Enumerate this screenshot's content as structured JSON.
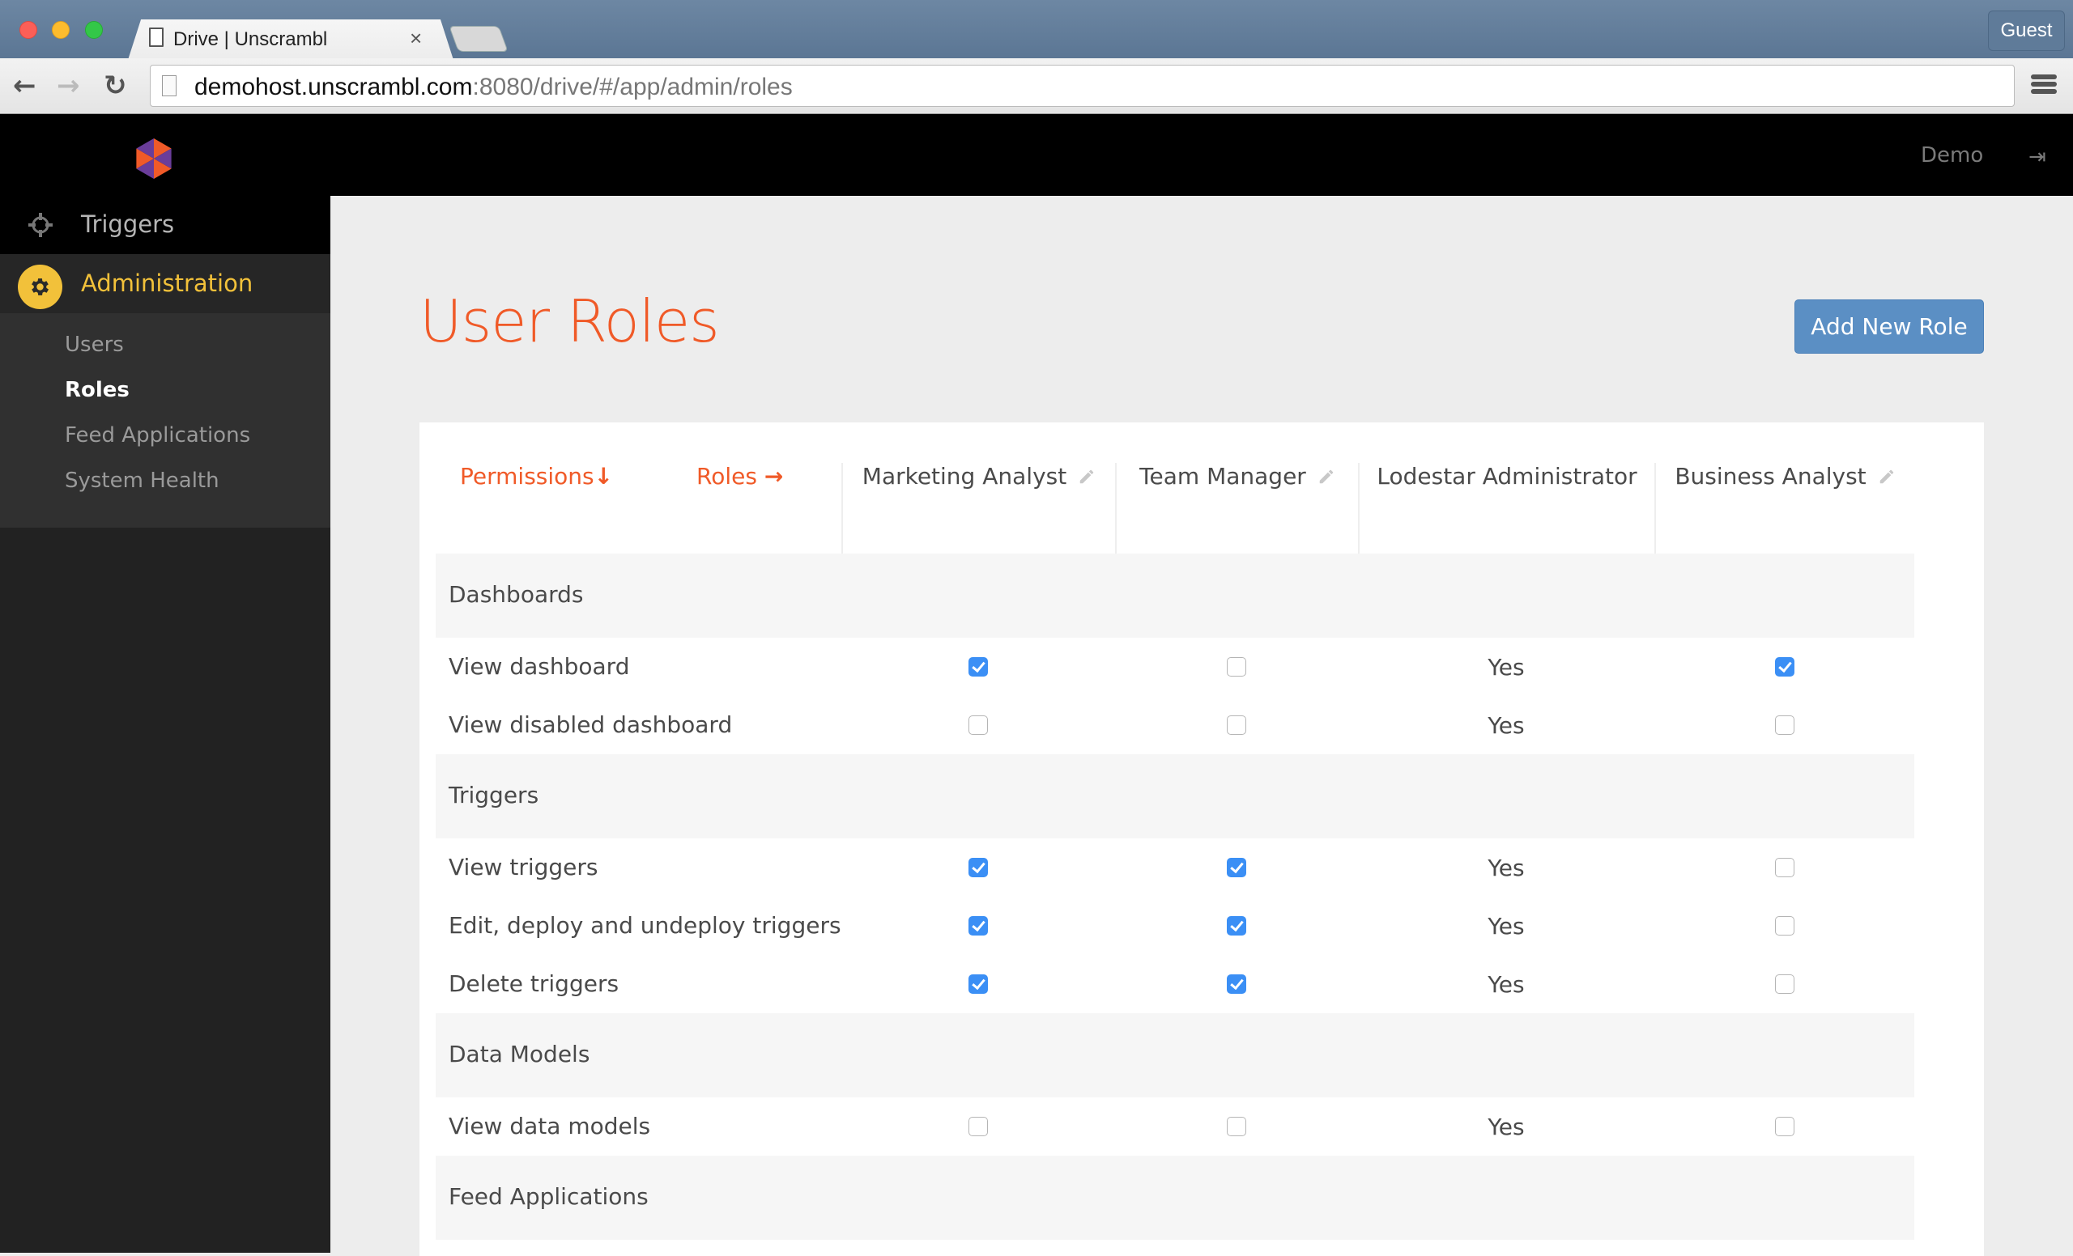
{
  "browser": {
    "tab_title": "Drive | Unscrambl",
    "tab_close": "×",
    "profile": "Guest",
    "url_host": "demohost.unscrambl.com",
    "url_rest": ":8080/drive/#/app/admin/roles",
    "icons": {
      "back": "←",
      "forward": "→",
      "reload": "↻"
    }
  },
  "header": {
    "user": "Demo",
    "logout_icon": "⇥"
  },
  "sidebar": {
    "items": [
      {
        "label": "Triggers",
        "icon": "crosshair-icon"
      },
      {
        "label": "Administration",
        "icon": "gear-icon",
        "active": true
      }
    ],
    "submenu": [
      {
        "label": "Users"
      },
      {
        "label": "Roles",
        "active": true
      },
      {
        "label": "Feed Applications"
      },
      {
        "label": "System Health"
      }
    ]
  },
  "main": {
    "title": "User Roles",
    "add_button": "Add New Role",
    "table": {
      "permissions_header": "Permissions",
      "permissions_arrow": "↓",
      "roles_header": "Roles",
      "roles_arrow": "→",
      "roles": [
        {
          "name": "Marketing Analyst",
          "editable": true
        },
        {
          "name": "Team Manager",
          "editable": true
        },
        {
          "name": "Lodestar Administrator",
          "editable": false
        },
        {
          "name": "Business Analyst",
          "editable": true
        }
      ],
      "yes_label": "Yes",
      "rows": [
        {
          "type": "section",
          "label": "Dashboards"
        },
        {
          "type": "item",
          "label": "View dashboard",
          "values": [
            true,
            false,
            "Yes",
            true
          ]
        },
        {
          "type": "item",
          "label": "View disabled dashboard",
          "values": [
            false,
            false,
            "Yes",
            false
          ]
        },
        {
          "type": "section",
          "label": "Triggers"
        },
        {
          "type": "item",
          "label": "View triggers",
          "values": [
            true,
            true,
            "Yes",
            false
          ]
        },
        {
          "type": "item",
          "label": "Edit, deploy and undeploy triggers",
          "values": [
            true,
            true,
            "Yes",
            false
          ]
        },
        {
          "type": "item",
          "label": "Delete triggers",
          "values": [
            true,
            true,
            "Yes",
            false
          ]
        },
        {
          "type": "section",
          "label": "Data Models"
        },
        {
          "type": "item",
          "label": "View data models",
          "values": [
            false,
            false,
            "Yes",
            false
          ]
        },
        {
          "type": "section",
          "label": "Feed Applications"
        }
      ]
    }
  },
  "colors": {
    "accent": "#f05a28",
    "button": "#5b8fc4",
    "checkbox_checked": "#3b8ff5",
    "admin_highlight": "#f2c13a"
  }
}
